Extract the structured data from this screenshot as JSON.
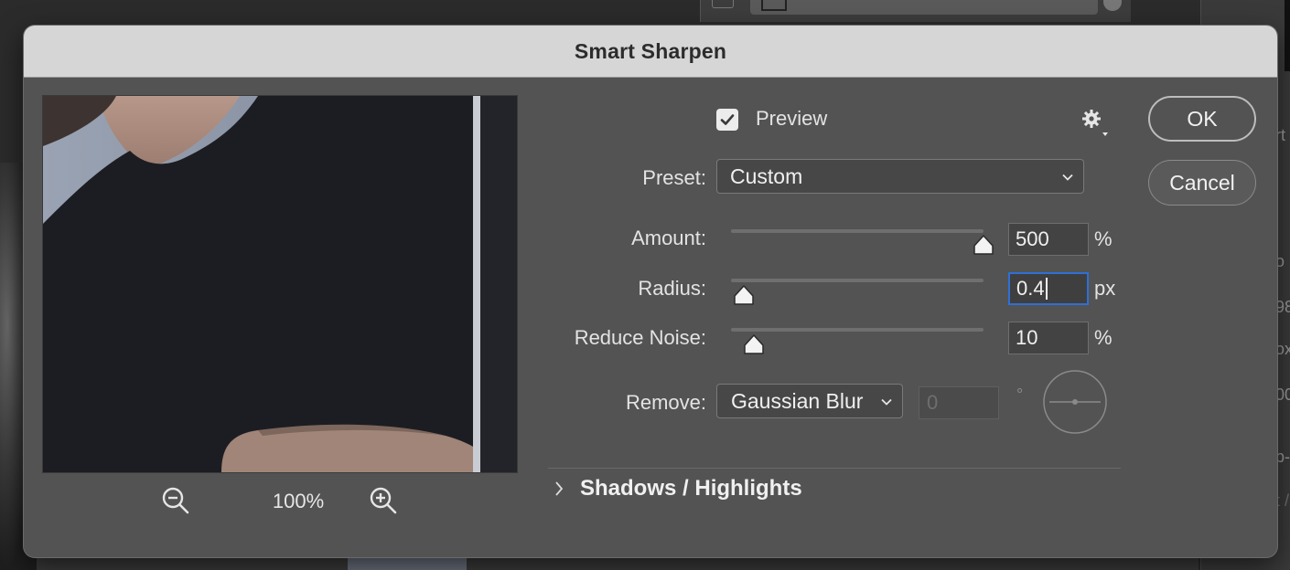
{
  "dialog": {
    "title": "Smart Sharpen"
  },
  "preview_pane": {
    "zoom_label": "100%",
    "zoom_out_icon": "zoom-out-icon",
    "zoom_in_icon": "zoom-in-icon"
  },
  "preview_checkbox": {
    "label": "Preview",
    "checked": true
  },
  "settings": {
    "icon": "gear-icon"
  },
  "preset": {
    "label": "Preset:",
    "value": "Custom"
  },
  "amount": {
    "label": "Amount:",
    "value": "500",
    "unit": "%",
    "fraction": 1.0
  },
  "radius": {
    "label": "Radius:",
    "value": "0.4",
    "unit": "px",
    "fraction": 0.05
  },
  "reduce_noise": {
    "label": "Reduce Noise:",
    "value": "10",
    "unit": "%",
    "fraction": 0.09
  },
  "remove": {
    "label": "Remove:",
    "value": "Gaussian Blur",
    "angle_value": "0",
    "angle_unit": "°"
  },
  "shadows_highlights": {
    "label": "Shadows / Highlights",
    "expanded": false
  },
  "buttons": {
    "ok": "OK",
    "cancel": "Cancel"
  },
  "background": {
    "right_panel_fragments": [
      "rt",
      "o",
      "98",
      "ox",
      "00",
      "p-",
      "t /"
    ]
  },
  "colors": {
    "dialog_bg": "#535353",
    "titlebar_bg": "#d6d6d6",
    "focus_blue": "#2f6fd6"
  }
}
